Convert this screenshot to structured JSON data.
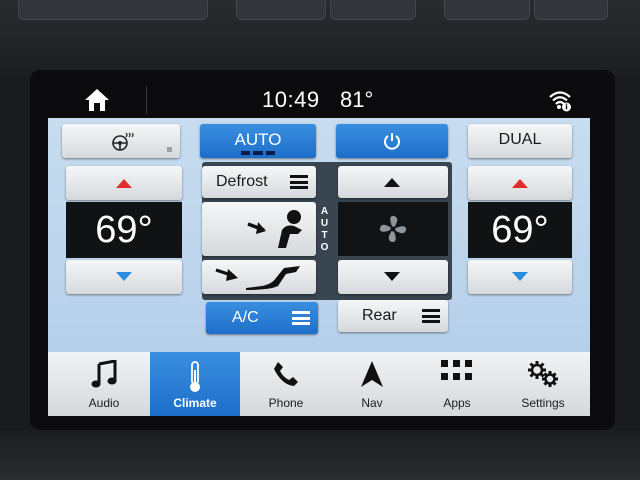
{
  "status": {
    "time": "10:49",
    "outside_temp": "81°"
  },
  "climate": {
    "auto_label": "AUTO",
    "dual_label": "DUAL",
    "driver_temp": "69°",
    "passenger_temp": "69°",
    "defrost_label": "Defrost",
    "ac_label": "A/C",
    "rear_label": "Rear",
    "fan_mode_label": "AUTO"
  },
  "nav": {
    "items": [
      {
        "label": "Audio",
        "icon": "music-note-icon"
      },
      {
        "label": "Climate",
        "icon": "thermometer-icon"
      },
      {
        "label": "Phone",
        "icon": "phone-icon"
      },
      {
        "label": "Nav",
        "icon": "navigation-arrow-icon"
      },
      {
        "label": "Apps",
        "icon": "apps-grid-icon"
      },
      {
        "label": "Settings",
        "icon": "gears-icon"
      }
    ],
    "active": "Climate"
  },
  "colors": {
    "accent_blue": "#1d6ec9",
    "heat_red": "#e22d2d",
    "cool_blue": "#2a8de0",
    "panel_bg": "#bcd4ec"
  }
}
